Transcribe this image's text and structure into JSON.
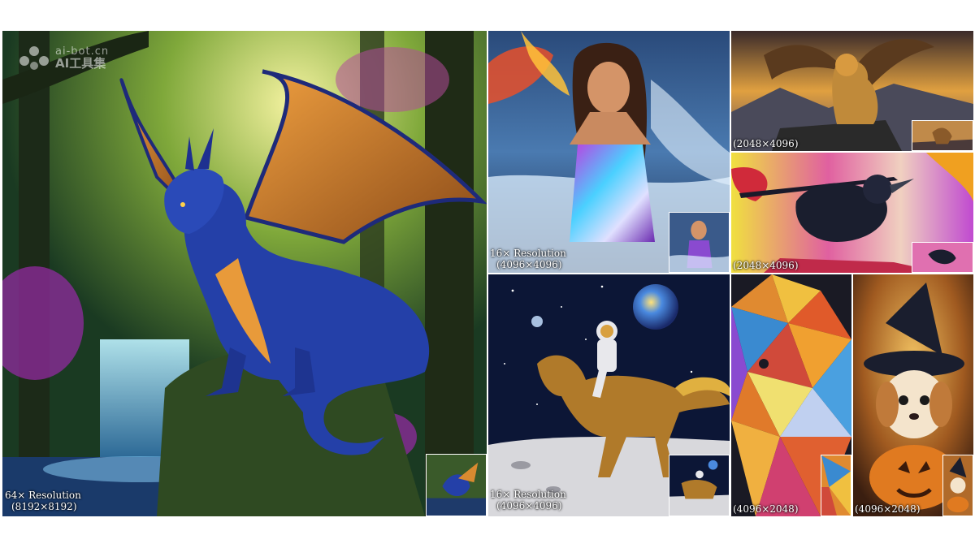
{
  "watermark": {
    "domain": "ai-bot.cn",
    "name": "AI工具集",
    "icon": "logo-cluster-icon"
  },
  "tiles": {
    "dragon": {
      "caption_line1": "64× Resolution",
      "caption_line2": "(8192×8192)"
    },
    "woman": {
      "caption_line1": "16× Resolution",
      "caption_line2": "(4096×4096)"
    },
    "astronaut": {
      "caption_line1": "16× Resolution",
      "caption_line2": "(4096×4096)"
    },
    "griffin": {
      "caption_line1": "(2048×4096)"
    },
    "crow": {
      "caption_line1": "(2048×4096)"
    },
    "lion": {
      "caption_line1": "(4096×2048)"
    },
    "puppy": {
      "caption_line1": "(4096×2048)"
    }
  },
  "colors": {
    "background": "#ffffff",
    "dragon_blue": "#1e3a9a",
    "forest_green": "#2f5a2a",
    "space_navy": "#0c1636",
    "sunset_orange": "#e08a30"
  }
}
